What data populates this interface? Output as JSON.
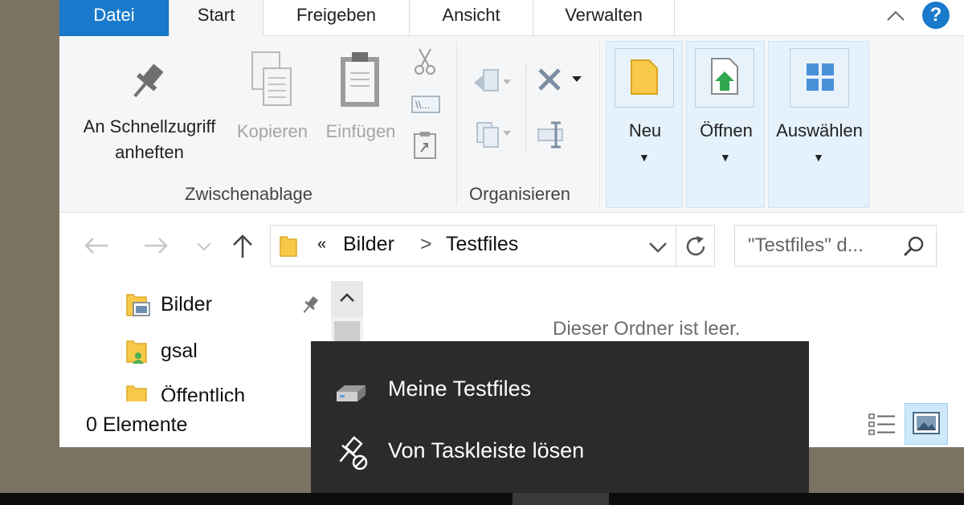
{
  "tabs": {
    "file": "Datei",
    "start": "Start",
    "share": "Freigeben",
    "view": "Ansicht",
    "manage": "Verwalten",
    "help": "?"
  },
  "ribbon": {
    "pin_line1": "An Schnellzugriff",
    "pin_line2": "anheften",
    "copy": "Kopieren",
    "paste": "Einfügen",
    "clipboard_group": "Zwischenablage",
    "organize_group": "Organisieren",
    "new": "Neu",
    "open": "Öffnen",
    "select": "Auswählen"
  },
  "address": {
    "overflow": "«",
    "segments": [
      "Bilder",
      "Testfiles"
    ],
    "separator": ">"
  },
  "search": {
    "placeholder": "\"Testfiles\" d..."
  },
  "nav_pane": {
    "items": [
      {
        "label": "Bilder",
        "icon": "pictures-folder-icon"
      },
      {
        "label": "gsal",
        "icon": "user-folder-icon"
      },
      {
        "label": "Öffentlich",
        "icon": "folder-icon"
      }
    ]
  },
  "content": {
    "empty_message": "Dieser Ordner ist leer."
  },
  "status": {
    "item_count": "0 Elemente"
  },
  "jumplist": {
    "items": [
      {
        "label": "Meine Testfiles",
        "icon": "drive-icon"
      },
      {
        "label": "Von Taskleiste lösen",
        "icon": "unpin-icon"
      }
    ]
  },
  "colors": {
    "accent": "#1979ca",
    "ribbon_bg": "#f5f6f7",
    "selected_bg": "#e5f1fb",
    "popup_bg": "#2b2b2b"
  }
}
